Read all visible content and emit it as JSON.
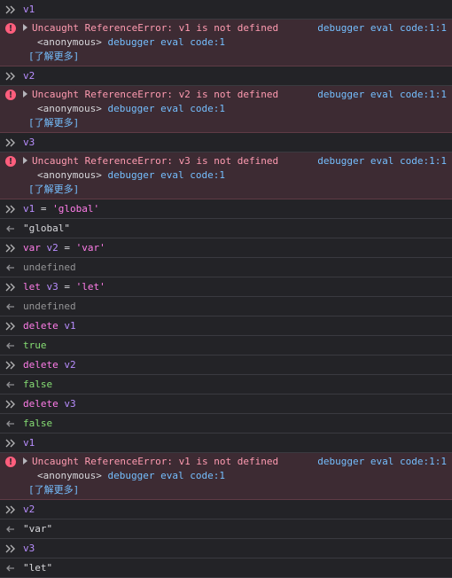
{
  "entries": [
    {
      "kind": "input",
      "tokens": [
        {
          "t": "v1",
          "c": "id-v"
        }
      ]
    },
    {
      "kind": "error",
      "message": "Uncaught ReferenceError: v1 is not defined",
      "location": "debugger eval code:1:1",
      "frame_fn": "<anonymous>",
      "frame_src": "debugger eval code:1",
      "more": "[了解更多]"
    },
    {
      "kind": "input",
      "tokens": [
        {
          "t": "v2",
          "c": "id-v"
        }
      ]
    },
    {
      "kind": "error",
      "message": "Uncaught ReferenceError: v2 is not defined",
      "location": "debugger eval code:1:1",
      "frame_fn": "<anonymous>",
      "frame_src": "debugger eval code:1",
      "more": "[了解更多]"
    },
    {
      "kind": "input",
      "tokens": [
        {
          "t": "v3",
          "c": "id-v"
        }
      ]
    },
    {
      "kind": "error",
      "message": "Uncaught ReferenceError: v3 is not defined",
      "location": "debugger eval code:1:1",
      "frame_fn": "<anonymous>",
      "frame_src": "debugger eval code:1",
      "more": "[了解更多]"
    },
    {
      "kind": "input",
      "tokens": [
        {
          "t": "v1",
          "c": "id-v"
        },
        {
          "t": " = ",
          "c": "plain"
        },
        {
          "t": "'global'",
          "c": "str"
        }
      ]
    },
    {
      "kind": "output",
      "text": "\"global\"",
      "c": "strval"
    },
    {
      "kind": "input",
      "tokens": [
        {
          "t": "var",
          "c": "kw"
        },
        {
          "t": " ",
          "c": "plain"
        },
        {
          "t": "v2",
          "c": "id-v"
        },
        {
          "t": " = ",
          "c": "plain"
        },
        {
          "t": "'var'",
          "c": "str"
        }
      ]
    },
    {
      "kind": "output",
      "text": "undefined",
      "c": "undef"
    },
    {
      "kind": "input",
      "tokens": [
        {
          "t": "let",
          "c": "kw"
        },
        {
          "t": " ",
          "c": "plain"
        },
        {
          "t": "v3",
          "c": "id-v"
        },
        {
          "t": " = ",
          "c": "plain"
        },
        {
          "t": "'let'",
          "c": "str"
        }
      ]
    },
    {
      "kind": "output",
      "text": "undefined",
      "c": "undef"
    },
    {
      "kind": "input",
      "tokens": [
        {
          "t": "delete",
          "c": "kw"
        },
        {
          "t": " ",
          "c": "plain"
        },
        {
          "t": "v1",
          "c": "id-v"
        }
      ]
    },
    {
      "kind": "output",
      "text": "true",
      "c": "bool"
    },
    {
      "kind": "input",
      "tokens": [
        {
          "t": "delete",
          "c": "kw"
        },
        {
          "t": " ",
          "c": "plain"
        },
        {
          "t": "v2",
          "c": "id-v"
        }
      ]
    },
    {
      "kind": "output",
      "text": "false",
      "c": "bool"
    },
    {
      "kind": "input",
      "tokens": [
        {
          "t": "delete",
          "c": "kw"
        },
        {
          "t": " ",
          "c": "plain"
        },
        {
          "t": "v3",
          "c": "id-v"
        }
      ]
    },
    {
      "kind": "output",
      "text": "false",
      "c": "bool"
    },
    {
      "kind": "input",
      "tokens": [
        {
          "t": "v1",
          "c": "id-v"
        }
      ]
    },
    {
      "kind": "error",
      "message": "Uncaught ReferenceError: v1 is not defined",
      "location": "debugger eval code:1:1",
      "frame_fn": "<anonymous>",
      "frame_src": "debugger eval code:1",
      "more": "[了解更多]"
    },
    {
      "kind": "input",
      "tokens": [
        {
          "t": "v2",
          "c": "id-v"
        }
      ]
    },
    {
      "kind": "output",
      "text": "\"var\"",
      "c": "strval"
    },
    {
      "kind": "input",
      "tokens": [
        {
          "t": "v3",
          "c": "id-v"
        }
      ]
    },
    {
      "kind": "output",
      "text": "\"let\"",
      "c": "strval"
    }
  ],
  "icons": {
    "input": "chevron-double-right-icon",
    "output": "arrow-left-icon",
    "error": "error-icon"
  },
  "colors": {
    "background": "#232327",
    "error_background": "#3d2b33",
    "error_text": "#ff9bb1",
    "link": "#75bfff",
    "keyword": "#ff7de9",
    "variable": "#b98eff",
    "boolean": "#86de74",
    "undefined": "#939395"
  }
}
